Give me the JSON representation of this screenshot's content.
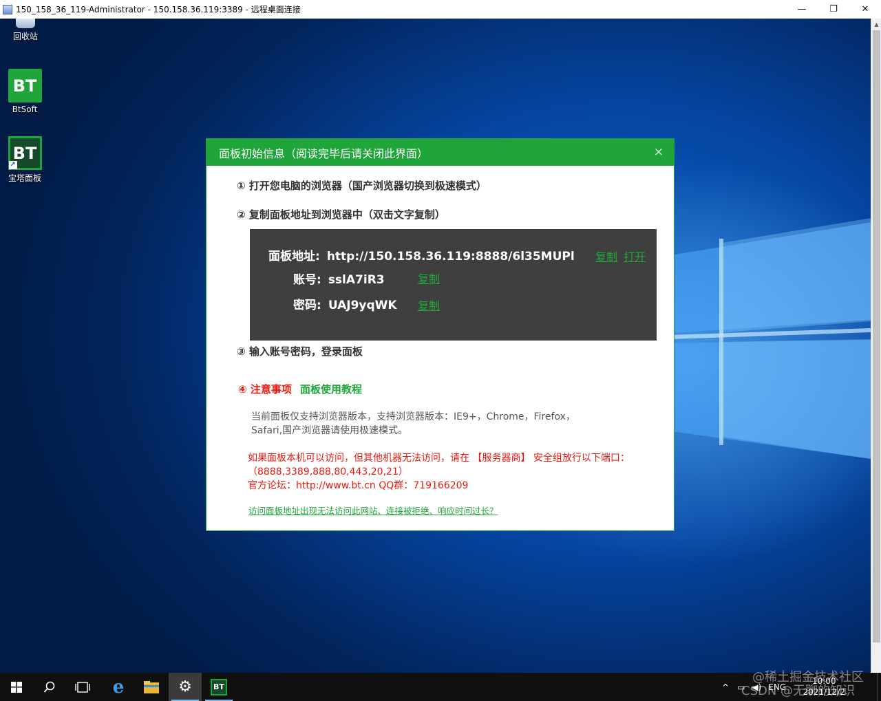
{
  "rdp_window": {
    "title": "150_158_36_119-Administrator - 150.158.36.119:3389 - 远程桌面连接",
    "minimize": "—",
    "restore": "❐",
    "close": "✕"
  },
  "desktop_icons": [
    {
      "label": "回收站",
      "icon": "recycle-bin-icon"
    },
    {
      "label": "BtSoft",
      "icon": "bt-icon",
      "glyph": "BT"
    },
    {
      "label": "宝塔面板",
      "icon": "bt-panel-icon",
      "glyph": "BT"
    }
  ],
  "dialog": {
    "title": "面板初始信息（阅读完毕后请关闭此界面）",
    "close": "×",
    "step1": "① 打开您电脑的浏览器（国产浏览器切换到极速模式）",
    "step2": "② 复制面板地址到浏览器中（双击文字复制）",
    "panel_address_label": "面板地址:",
    "panel_address": "http://150.158.36.119:8888/6l35MUPl",
    "account_label": "账号:",
    "account": "sslA7iR3",
    "password_label": "密码:",
    "password": "UAJ9yqWK",
    "copy": "复制",
    "open": "打开",
    "step3": "③ 输入账号密码，登录面板",
    "notice_title": "④ 注意事项",
    "tutorial_link": "面板使用教程",
    "browser_note_1": "当前面板仅支持浏览器版本，支持浏览器版本：IE9+，Chrome，Firefox，",
    "browser_note_2": "Safari,国产浏览器请使用极速模式。",
    "ports_note_1": "如果面板本机可以访问，但其他机器无法访问，请在 【服务器商】 安全组放行以下端口：",
    "ports_note_2": "（8888,3389,888,80,443,20,21）",
    "forum_note": "官方论坛：http://www.bt.cn  QQ群：719166209",
    "help_link": "访问面板地址出现无法访问此网站、连接被拒绝、响应时间过长？"
  },
  "taskbar": {
    "items": [
      "start-icon",
      "search-icon",
      "task-view-icon",
      "edge-ie-icon",
      "file-explorer-icon",
      "settings-icon",
      "bt-panel-taskbar-icon"
    ],
    "bt_glyph": "BT",
    "tray_chevron": "^",
    "tray_lang": "ENG",
    "time": "10:00",
    "date": "2021/12/2"
  },
  "watermarks": [
    "@稀土掘金技术社区",
    "CSDN @无聊的知识"
  ],
  "colors": {
    "accent": "#20a53a",
    "warning": "#e8190e",
    "panel": "#3f3f3f"
  }
}
